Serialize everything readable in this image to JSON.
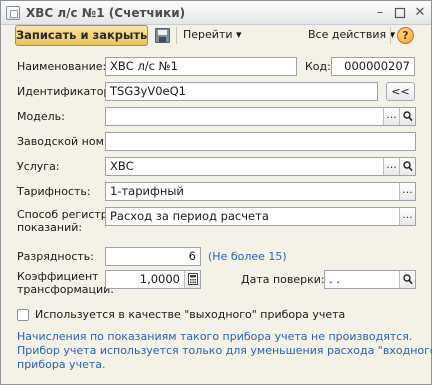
{
  "window": {
    "title": "ХВС л/с №1 (Счетчики)"
  },
  "toolbar": {
    "save_close_label": "Записать и закрыть",
    "goto_label": "Перейти",
    "all_actions_label": "Все действия",
    "help_label": "?"
  },
  "form": {
    "name": {
      "label": "Наименование:",
      "value": "ХВС л/с №1"
    },
    "code": {
      "label": "Код:",
      "value": "000000207"
    },
    "identifier": {
      "label": "Идентификатор:",
      "value": "TSG3yV0eQ1",
      "button": "<<"
    },
    "model": {
      "label": "Модель:",
      "value": ""
    },
    "serial": {
      "label": "Заводской ном.:",
      "value": ""
    },
    "service": {
      "label": "Услуга:",
      "value": "ХВС"
    },
    "tariff": {
      "label": "Тарифность:",
      "value": "1-тарифный"
    },
    "reg_method": {
      "label_line1": "Способ регистр.",
      "label_line2": "показаний:",
      "value": "Расход за период расчета"
    },
    "digits": {
      "label": "Разрядность:",
      "value": "6",
      "hint": "(Не более 15)"
    },
    "coef": {
      "label_line1": "Коэффициент",
      "label_line2": "трансформации:",
      "value": "1,0000"
    },
    "verify_date": {
      "label": "Дата поверки:",
      "value": " .  ."
    },
    "output_device": {
      "label": "Используется в качестве \"выходного\" прибора учета",
      "checked": false
    },
    "note_lines": [
      "Начисления по показаниям такого прибора учета не производятся.",
      "Прибор учета используется только для уменьшения расхода \"входного\"",
      "прибора учета."
    ]
  }
}
